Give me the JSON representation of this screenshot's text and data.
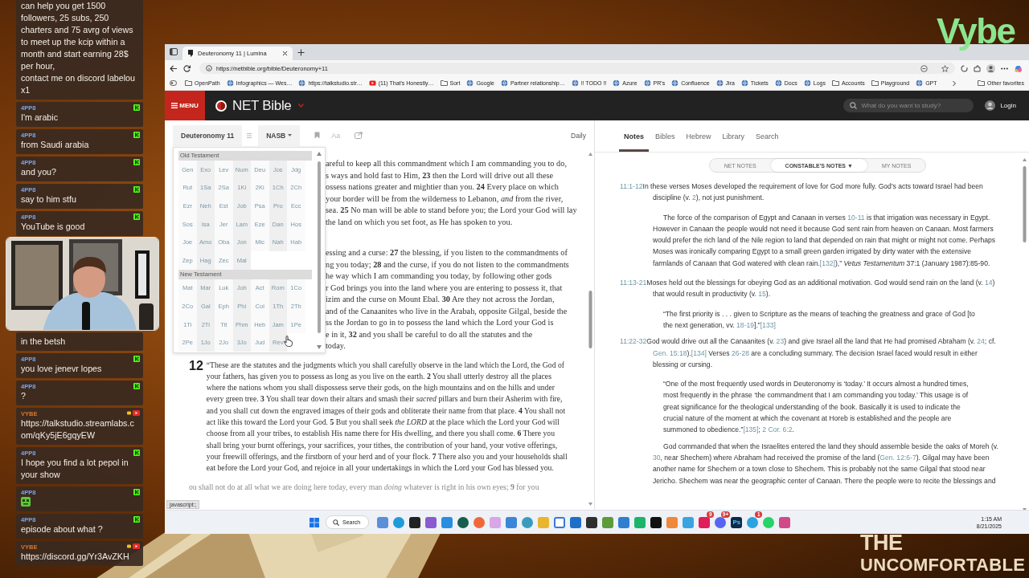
{
  "stream": {
    "logo": "Vybe",
    "show_title": [
      "THE",
      "UNCOMFORTABLE"
    ]
  },
  "chat": {
    "messages": [
      {
        "kind": "continued",
        "text": "can help you get 1500 followers, 25 subs, 250 charters and 75 avrg of views to meet up the kcip within a month and start earning 28$ per hour,\ncontact me on discord labelou x1"
      },
      {
        "kind": "kick",
        "user": "4PP8",
        "text": "I'm arabic"
      },
      {
        "kind": "kick",
        "user": "4PP8",
        "text": "from Saudi arabia"
      },
      {
        "kind": "kick",
        "user": "4PP8",
        "text": "and you?"
      },
      {
        "kind": "kick",
        "user": "4PP8",
        "text": "say to him stfu"
      },
      {
        "kind": "kick",
        "user": "4PP8",
        "text": "YouTube is good"
      },
      {
        "kind": "picture"
      },
      {
        "kind": "continued",
        "text": "in the betsh"
      },
      {
        "kind": "kick",
        "user": "4PP8",
        "text": "you love jenevr lopes"
      },
      {
        "kind": "kick",
        "user": "4PP8",
        "text": "?"
      },
      {
        "kind": "host",
        "user": "VYBE",
        "text": "https://talkstudio.streamlabs.com/qKy5jE6gqyEW"
      },
      {
        "kind": "kick",
        "user": "4PP8",
        "text": "I hope you find a lot pepol in your show"
      },
      {
        "kind": "kick",
        "user": "4PP8",
        "emote": true
      },
      {
        "kind": "kick",
        "user": "4PP8",
        "text": "episode about what ?"
      },
      {
        "kind": "host",
        "user": "VYBE",
        "text": "https://discord.gg/Yr3AvZKH"
      }
    ]
  },
  "browser": {
    "tab": {
      "title": "Deuteronomy 11 | Lumina"
    },
    "address": "https://netbible.org/bible/Deuteronomy+11",
    "bookmarks": [
      {
        "label": "OpenPath",
        "kind": "folder"
      },
      {
        "label": "Infographics — Wes…",
        "kind": "site"
      },
      {
        "label": "https://talkstudio.str…",
        "kind": "site"
      },
      {
        "label": "(11) That's Honestly…",
        "kind": "video"
      },
      {
        "label": "Sort",
        "kind": "folder"
      },
      {
        "label": "Google",
        "kind": "site"
      },
      {
        "label": "Partner relationship…",
        "kind": "site"
      },
      {
        "label": "!! TODO !!",
        "kind": "site"
      },
      {
        "label": "Azure",
        "kind": "site"
      },
      {
        "label": "PR's",
        "kind": "site"
      },
      {
        "label": "Confluence",
        "kind": "site"
      },
      {
        "label": "Jira",
        "kind": "site"
      },
      {
        "label": "Tickets",
        "kind": "site"
      },
      {
        "label": "Docs",
        "kind": "site"
      },
      {
        "label": "Logs",
        "kind": "site"
      },
      {
        "label": "Accounts",
        "kind": "folder"
      },
      {
        "label": "Playground",
        "kind": "folder"
      },
      {
        "label": "GPT",
        "kind": "site"
      }
    ],
    "other_favorites": "Other favorites",
    "status_tooltip": "javascript:;"
  },
  "site": {
    "menu": "MENU",
    "brand": "NET Bible",
    "search": {
      "placeholder": "What do you want to study?"
    },
    "login": "Login"
  },
  "reader": {
    "book": "Deuteronomy 11",
    "version": "NASB",
    "font_button": "Aa",
    "daily": "Daily",
    "book_picker": {
      "sections": [
        {
          "title": "Old Testament",
          "books": [
            "Gen",
            "Exo",
            "Lev",
            "Num",
            "Deu",
            "Jos",
            "Jdg",
            "Rut",
            "1Sa",
            "2Sa",
            "1Ki",
            "2Ki",
            "1Ch",
            "2Ch",
            "Ezr",
            "Neh",
            "Est",
            "Job",
            "Psa",
            "Pro",
            "Ecc",
            "Sos",
            "Isa",
            "Jer",
            "Lam",
            "Eze",
            "Dan",
            "Hos",
            "Joe",
            "Amo",
            "Oba",
            "Jon",
            "Mic",
            "Nah",
            "Hab",
            "Zep",
            "Hag",
            "Zec",
            "Mal"
          ]
        },
        {
          "title": "New Testament",
          "books": [
            "Mat",
            "Mar",
            "Luk",
            "Joh",
            "Act",
            "Rom",
            "1Co",
            "2Co",
            "Gal",
            "Eph",
            "Phi",
            "Col",
            "1Th",
            "2Th",
            "1Ti",
            "2Ti",
            "Tit",
            "Phm",
            "Heb",
            "Jam",
            "1Pe",
            "2Pe",
            "1Jo",
            "2Jo",
            "3Jo",
            "Jud",
            "Rev"
          ]
        }
      ]
    },
    "fragments": [
      [
        "areful to keep all this commandment which I am commanding you to do,",
        "s ways and hold fast to Him, **23** then the Lord will drive out all these",
        "ossess nations greater and mightier than you. **24** Every place on which",
        "your border will be from the wilderness to Lebanon, *and* from the river,",
        "sea. **25** No man will be able to stand before you; the Lord your God will lay",
        "the land on which you set foot, as He has spoken to you."
      ],
      [
        "essing and a curse: **27** the blessing, if you listen to the commandments of",
        "ng you today; **28** and the curse, if you do not listen to the commandments",
        "he way which I am commanding you today, by following other gods"
      ],
      [
        "r God brings you into the land where you are entering to possess it, that",
        "izim and the curse on Mount Ebal. **30** Are they not across the Jordan,",
        "and of the Canaanites who live in the Arabah, opposite Gilgal, beside the",
        "ss the Jordan to go in to possess the land which the Lord your God is",
        "e in it, **32** and you shall be careful to do all the statutes and the",
        "today."
      ]
    ],
    "chapter": {
      "number": "12",
      "text": "“These are the statutes and the judgments which you shall carefully observe in the land which the Lord, the God of your fathers, has given you to possess as long as you live on the earth. **2** You shall utterly destroy all the places where the nations whom you shall dispossess serve their gods, on the high mountains and on the hills and under every green tree. **3** You shall tear down their altars and smash their *sacred* pillars and burn their Asherim with fire, and you shall cut down the engraved images of their gods and obliterate their name from that place. **4** You shall not act like this toward the Lord your God. **5** But you shall seek *the LORD* at the place which the Lord your God will choose from all your tribes, to establish His name there for His dwelling, and there you shall come. **6** There you shall bring your burnt offerings, your sacrifices, your tithes, the contribution of your hand, your votive offerings, your freewill offerings, and the firstborn of your herd and of your flock. **7** There also you and your households shall eat before the Lord your God, and rejoice in all your undertakings in which the Lord your God has blessed you."
    },
    "faded_line": "ou shall not do at all what we are doing here today, every man *doing* whatever is right in his own eyes; **9** for you"
  },
  "study": {
    "tabs": [
      {
        "label": "Notes",
        "selected": true
      },
      {
        "label": "Bibles",
        "selected": false
      },
      {
        "label": "Hebrew",
        "selected": false
      },
      {
        "label": "Library",
        "selected": false
      },
      {
        "label": "Search",
        "selected": false
      }
    ],
    "note_sources": [
      {
        "label": "NET NOTES",
        "selected": false
      },
      {
        "label": "CONSTABLE'S NOTES ▼",
        "selected": true
      },
      {
        "label": "MY NOTES",
        "selected": false
      }
    ],
    "notes": [
      {
        "ref": "11:1-12",
        "paragraphs": [
          {
            "kind": "lead",
            "segments": [
              "In these verses Moses developed the requirement of love for God more fully. God's acts toward Israel had been discipline (v. ",
              {
                "link": "2"
              },
              "), not just punishment."
            ]
          },
          {
            "kind": "body",
            "segments": [
              "The force of the comparison of Egypt and Canaan in verses ",
              {
                "link": "10-11"
              },
              " is that irrigation was necessary in Egypt. However in Canaan the people would not need it because God sent rain from heaven on Canaan. Most farmers would prefer the rich land of the Nile region to land that depended on rain that might or might not come. Perhaps Moses was ironically comparing Egypt to a small green garden irrigated by dirty water with the extensive farmlands of Canaan that God watered with clean rain.",
              {
                "link": "[132]"
              },
              "),” *Vetus Testamentum* 37:1 (January 1987):85-90."
            ]
          }
        ]
      },
      {
        "ref": "11:13-21",
        "paragraphs": [
          {
            "kind": "lead",
            "segments": [
              "Moses held out the blessings for obeying God as an additional motivation. God would send rain on the land (v. ",
              {
                "link": "14"
              },
              ") that would result in productivity (v. ",
              {
                "link": "15"
              },
              ")."
            ]
          },
          {
            "kind": "quote",
            "segments": [
              "“The first priority is . . . given to Scripture as the means of teaching the greatness and grace of God [to the next generation, vv. ",
              {
                "link": "18-19"
              },
              "].”",
              {
                "link": "[133]"
              }
            ]
          }
        ]
      },
      {
        "ref": "11:22-32",
        "paragraphs": [
          {
            "kind": "lead",
            "segments": [
              "God would drive out all the Canaanites (v. ",
              {
                "link": "23"
              },
              ") and give Israel all the land that He had promised Abraham (v. ",
              {
                "link": "24"
              },
              "; cf. ",
              {
                "link": "Gen. 15:18"
              },
              ").",
              {
                "link": "[134]"
              },
              " Verses ",
              {
                "link": "26-28"
              },
              " are a concluding summary. The decision Israel faced would result in either blessing or cursing."
            ]
          },
          {
            "kind": "quote",
            "segments": [
              "“One of the most frequently used words in Deuteronomy is ‘today.’ It occurs almost a hundred times, most frequently in the phrase ‘the commandment that I am commanding you today.’ This usage is of great significance for the theological understanding of the book. Basically it is used to indicate the crucial nature of the moment at which the covenant at Horeb is established and the people are summoned to obedience.”",
              {
                "link": "[135]"
              },
              "; ",
              {
                "link": "2 Cor. 6:2"
              },
              "."
            ]
          },
          {
            "kind": "body",
            "segments": [
              "God commanded that when the Israelites entered the land they should assemble beside the oaks of Moreh (v. ",
              {
                "link": "30"
              },
              ", near Shechem) where Abraham had received the promise of the land (",
              {
                "link": "Gen. 12:6-7"
              },
              "). Gilgal may have been another name for Shechem or a town close to Shechem. This is probably not the same Gilgal that stood near Jericho. Shechem was near the geographic center of Canaan. There the people were to recite the blessings and"
            ]
          }
        ]
      }
    ]
  },
  "taskbar": {
    "search": "Search",
    "apps": [
      {
        "kind": "widgets"
      },
      {
        "kind": "edge"
      },
      {
        "kind": "notion"
      },
      {
        "kind": "vs"
      },
      {
        "kind": "vscode"
      },
      {
        "kind": "chatgpt"
      },
      {
        "kind": "postman"
      },
      {
        "kind": "snip"
      },
      {
        "kind": "notepad"
      },
      {
        "kind": "globe"
      },
      {
        "kind": "files"
      },
      {
        "kind": "window"
      },
      {
        "kind": "outlook"
      },
      {
        "kind": "terminal"
      },
      {
        "kind": "minecraft"
      },
      {
        "kind": "vpn"
      },
      {
        "kind": "green"
      },
      {
        "kind": "capcut"
      },
      {
        "kind": "sniptool"
      },
      {
        "kind": "azure"
      },
      {
        "kind": "slack",
        "badge": "9"
      },
      {
        "kind": "discord",
        "badge": "9+"
      },
      {
        "kind": "photoshop",
        "label": "Ps"
      },
      {
        "kind": "telegram",
        "badge": "1"
      },
      {
        "kind": "whatsapp"
      },
      {
        "kind": "misc"
      }
    ],
    "time": "1:15 AM",
    "date": "8/21/2025"
  }
}
